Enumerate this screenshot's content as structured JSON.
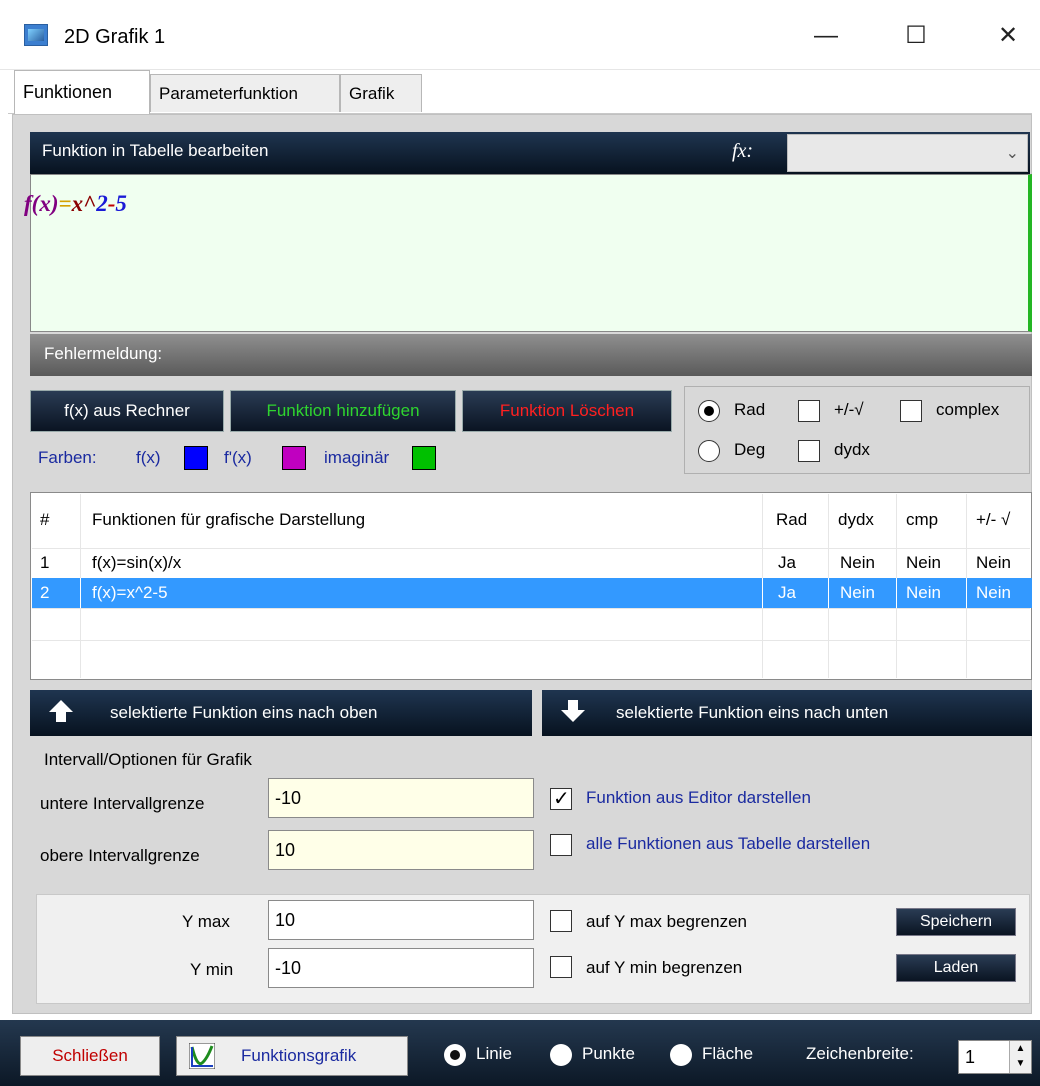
{
  "window": {
    "title": "2D Grafik 1",
    "minimize": "—",
    "maximize": "☐",
    "close": "✕"
  },
  "tabs": [
    "Funktionen",
    "Parameterfunktion",
    "Grafik"
  ],
  "editor_section": {
    "header": "Funktion in Tabelle bearbeiten",
    "fx_label": "fx:",
    "fx_value": "",
    "formula": {
      "f": "f(x)",
      "eq": "=",
      "x": "x",
      "caret": "^",
      "exp": "2",
      "minus": "-",
      "const": "5"
    },
    "error_label": "Fehlermeldung:"
  },
  "buttons": {
    "from_calc": "f(x) aus Rechner",
    "add_function": "Funktion hinzufügen",
    "delete_function": "Funktion Löschen"
  },
  "colors_row": {
    "label": "Farben:",
    "fx": "f(x)",
    "dfx": "f'(x)",
    "imag": "imaginär"
  },
  "colors": {
    "fx": "#0000ff",
    "dfx": "#c000c0",
    "imag": "#00c000",
    "add_text": "#2fd42f",
    "delete_text": "#ff2020"
  },
  "options": {
    "rad": "Rad",
    "deg": "Deg",
    "plusminus": "+/-√",
    "dydx": "dydx",
    "complex": "complex",
    "rad_selected": true
  },
  "table": {
    "headers": [
      "#",
      "Funktionen für grafische Darstellung",
      "Rad",
      "dydx",
      "cmp",
      "+/- √"
    ],
    "rows": [
      {
        "num": "1",
        "func": "f(x)=sin(x)/x",
        "rad": "Ja",
        "dydx": "Nein",
        "cmp": "Nein",
        "pm": "Nein"
      },
      {
        "num": "2",
        "func": "f(x)=x^2-5",
        "rad": "Ja",
        "dydx": "Nein",
        "cmp": "Nein",
        "pm": "Nein"
      }
    ]
  },
  "move": {
    "up": "selektierte Funktion eins nach oben",
    "down": "selektierte Funktion eins nach unten"
  },
  "interval": {
    "title": "Intervall/Optionen für Grafik",
    "lower_label": "untere Intervallgrenze",
    "lower_value": "-10",
    "upper_label": "obere Intervallgrenze",
    "upper_value": "10",
    "show_editor": "Funktion aus Editor darstellen",
    "show_all": "alle Funktionen aus Tabelle  darstellen"
  },
  "yrange": {
    "ymax_label": "Y max",
    "ymax_value": "10",
    "ymin_label": "Y min",
    "ymin_value": "-10",
    "limit_max": "auf Y max begrenzen",
    "limit_min": "auf Y min begrenzen",
    "save": "Speichern",
    "load": "Laden"
  },
  "footer": {
    "close": "Schließen",
    "graph": "Funktionsgrafik",
    "line": "Linie",
    "points": "Punkte",
    "area": "Fläche",
    "width_label": "Zeichenbreite:",
    "width_value": "1"
  }
}
